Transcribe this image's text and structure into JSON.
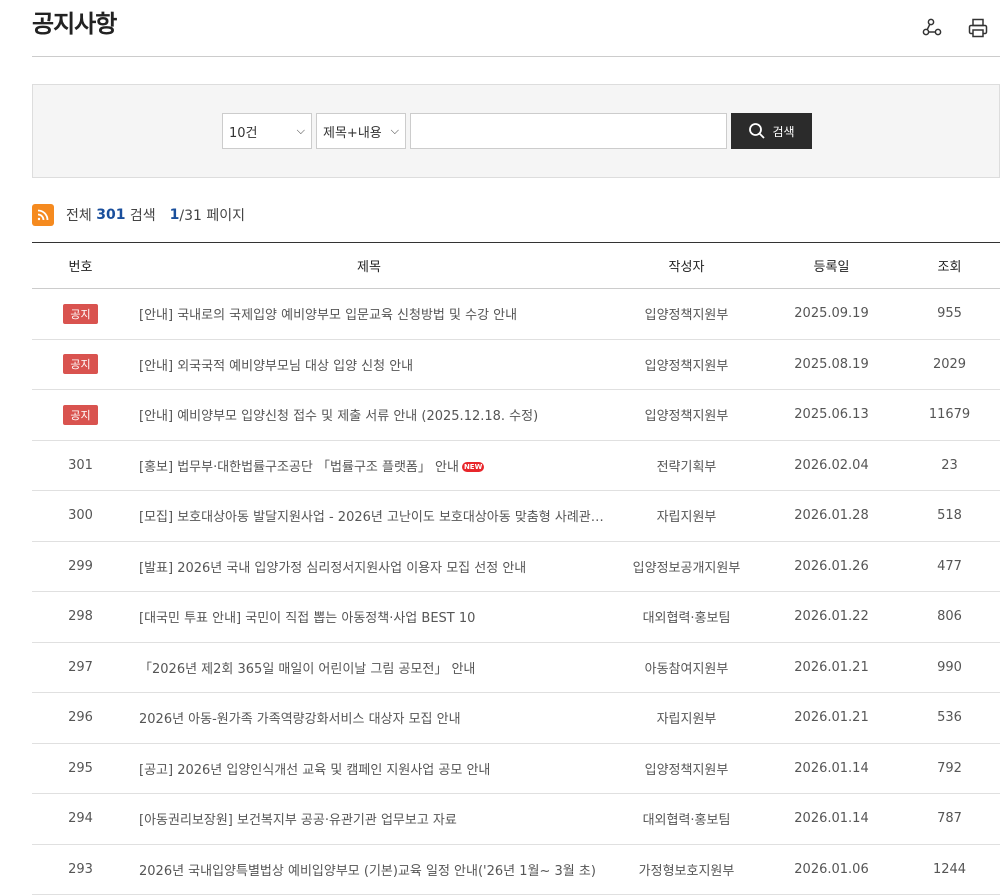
{
  "page": {
    "title": "공지사항"
  },
  "toolbar": {
    "share_icon": "share-icon",
    "print_icon": "print-icon"
  },
  "search": {
    "count_selected": "10건",
    "field_selected": "제목+내용",
    "keyword_value": "",
    "button_label": "검색"
  },
  "summary": {
    "total_label": "전체",
    "total_count": "301",
    "search_label": "검색",
    "current_page": "1",
    "total_pages": "/31 페이지"
  },
  "table": {
    "headers": {
      "no": "번호",
      "subject": "제목",
      "author": "작성자",
      "date": "등록일",
      "views": "조회"
    },
    "rows": [
      {
        "no": "공지",
        "notice": true,
        "new": false,
        "subject": "[안내] 국내로의 국제입양 예비양부모 입문교육 신청방법 및 수강 안내",
        "author": "입양정책지원부",
        "date": "2025.09.19",
        "views": "955"
      },
      {
        "no": "공지",
        "notice": true,
        "new": false,
        "subject": "[안내] 외국국적 예비양부모님 대상 입양 신청 안내",
        "author": "입양정책지원부",
        "date": "2025.08.19",
        "views": "2029"
      },
      {
        "no": "공지",
        "notice": true,
        "new": false,
        "subject": "[안내] 예비양부모 입양신청 접수 및 제출 서류 안내 (2025.12.18. 수정)",
        "author": "입양정책지원부",
        "date": "2025.06.13",
        "views": "11679"
      },
      {
        "no": "301",
        "notice": false,
        "new": true,
        "subject": "[홍보] 법무부·대한법률구조공단 「법률구조 플랫폼」 안내",
        "author": "전략기획부",
        "date": "2026.02.04",
        "views": "23"
      },
      {
        "no": "300",
        "notice": false,
        "new": false,
        "subject": "[모집] 보호대상아동 발달지원사업 - 2026년 고난이도 보호대상아동 맞춤형 사례관리서...",
        "author": "자립지원부",
        "date": "2026.01.28",
        "views": "518"
      },
      {
        "no": "299",
        "notice": false,
        "new": false,
        "subject": "[발표] 2026년 국내 입양가정 심리정서지원사업 이용자 모집 선정 안내",
        "author": "입양정보공개지원부",
        "date": "2026.01.26",
        "views": "477"
      },
      {
        "no": "298",
        "notice": false,
        "new": false,
        "subject": "[대국민 투표 안내] 국민이 직접 뽑는 아동정책·사업 BEST 10",
        "author": "대외협력·홍보팀",
        "date": "2026.01.22",
        "views": "806"
      },
      {
        "no": "297",
        "notice": false,
        "new": false,
        "subject": "「2026년 제2회 365일 매일이 어린이날 그림 공모전」 안내",
        "author": "아동참여지원부",
        "date": "2026.01.21",
        "views": "990"
      },
      {
        "no": "296",
        "notice": false,
        "new": false,
        "subject": "2026년 아동-원가족 가족역량강화서비스 대상자 모집 안내",
        "author": "자립지원부",
        "date": "2026.01.21",
        "views": "536"
      },
      {
        "no": "295",
        "notice": false,
        "new": false,
        "subject": "[공고] 2026년 입양인식개선 교육 및 캠페인 지원사업 공모 안내",
        "author": "입양정책지원부",
        "date": "2026.01.14",
        "views": "792"
      },
      {
        "no": "294",
        "notice": false,
        "new": false,
        "subject": "[아동권리보장원] 보건복지부 공공·유관기관 업무보고 자료",
        "author": "대외협력·홍보팀",
        "date": "2026.01.14",
        "views": "787"
      },
      {
        "no": "293",
        "notice": false,
        "new": false,
        "subject": "2026년 국내입양특별법상 예비입양부모 (기본)교육 일정 안내('26년 1월~ 3월 초)",
        "author": "가정형보호지원부",
        "date": "2026.01.06",
        "views": "1244"
      }
    ]
  },
  "badges": {
    "new_label": "NEW"
  },
  "colors": {
    "accent_blue": "#1a4f9c",
    "notice_red": "#d9534f",
    "rss_orange": "#f58a1f",
    "button_dark": "#2b2b2b"
  }
}
